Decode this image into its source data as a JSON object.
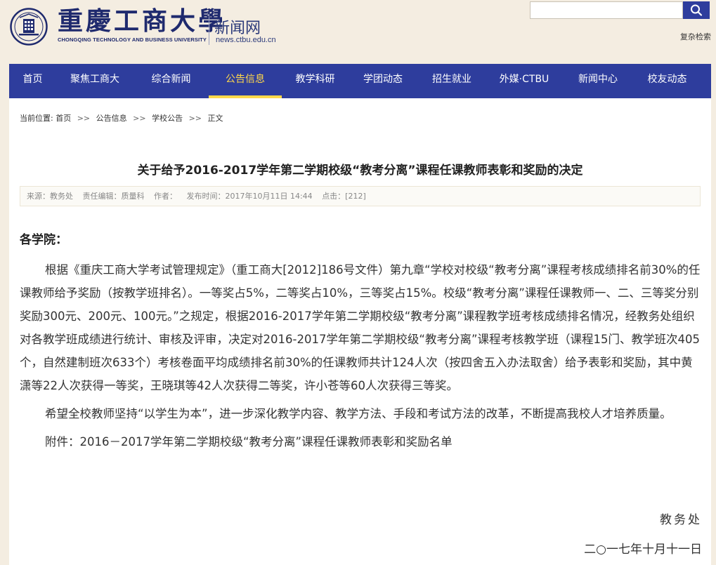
{
  "header": {
    "logo_cn": "重慶工商大學",
    "logo_en": "CHONGQING TECHNOLOGY AND BUSINESS UNIVERSITY",
    "site_name": "新闻网",
    "site_domain": "news.ctbu.edu.cn",
    "search": {
      "placeholder": "",
      "icon": "search-icon"
    },
    "traditional_link": "复杂检索"
  },
  "nav": {
    "items": [
      {
        "label": "首页",
        "active": false
      },
      {
        "label": "聚焦工商大",
        "active": false
      },
      {
        "label": "综合新闻",
        "active": false
      },
      {
        "label": "公告信息",
        "active": true
      },
      {
        "label": "教学科研",
        "active": false
      },
      {
        "label": "学团动态",
        "active": false
      },
      {
        "label": "招生就业",
        "active": false
      },
      {
        "label": "外媒·CTBU",
        "active": false
      },
      {
        "label": "新闻中心",
        "active": false
      },
      {
        "label": "校友动态",
        "active": false
      }
    ]
  },
  "breadcrumb": {
    "prefix": "当前位置:",
    "items": [
      "首页",
      "公告信息",
      "学校公告",
      "正文"
    ],
    "separator": ">>"
  },
  "article": {
    "title": "关于给予2016-2017学年第二学期校级“教考分离”课程任课教师表彰和奖励的决定",
    "meta": {
      "source": "来源：教务处",
      "editor": "责任编辑：质量科",
      "author": "作者：",
      "published": "发布时间：2017年10月11日 14:44",
      "clicks": "点击：[212]"
    },
    "salutation": "各学院：",
    "paragraphs": [
      "根据《重庆工商大学考试管理规定》（重工商大[2012]186号文件）第九章“学校对校级“教考分离”课程考核成绩排名前30%的任课教师给予奖励（按教学班排名）。一等奖占5%，二等奖占10%，三等奖占15%。校级“教考分离”课程任课教师一、二、三等奖分别奖励300元、200元、100元。”之规定，根据2016-2017学年第二学期校级“教考分离”课程教学班考核成绩排名情况，经教务处组织对各教学班成绩进行统计、审核及评审，决定对2016-2017学年第二学期校级“教考分离”课程考核教学班（课程15门、教学班次405个，自然建制班次633个）考核卷面平均成绩排名前30%的任课教师共计124人次（按四舍五入办法取舍）给予表彰和奖励，其中黄潇等22人次获得一等奖，王晓琪等42人次获得二等奖，许小苍等60人次获得三等奖。",
      "希望全校教师坚持“以学生为本”，进一步深化教学内容、教学方法、手段和考试方法的改革，不断提高我校人才培养质量。",
      "附件：2016－2017学年第二学期校级“教考分离”课程任课教师表彰和奖励名单"
    ],
    "signer": "教务处",
    "date": "二○一七年十月十一日"
  },
  "colors": {
    "page_bg": "#f4ede1",
    "nav_bg": "#2e3d9d",
    "nav_active": "#ffd84a",
    "brand_blue": "#1f2a6e"
  }
}
